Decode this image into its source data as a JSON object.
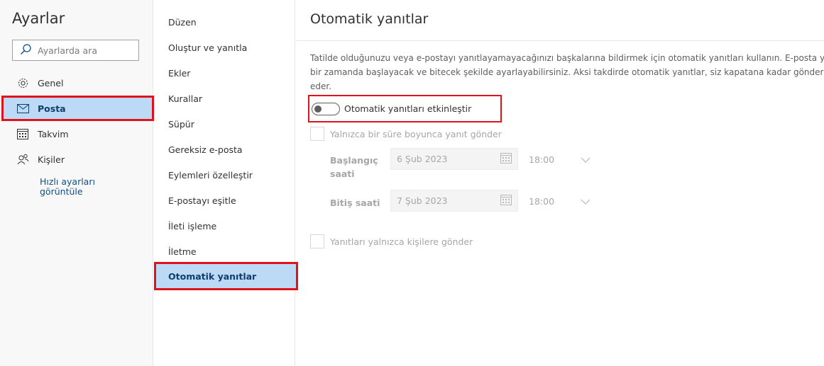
{
  "settings": {
    "title": "Ayarlar",
    "search_placeholder": "Ayarlarda ara",
    "nav": [
      {
        "label": "Genel",
        "icon": "gear-icon"
      },
      {
        "label": "Posta",
        "icon": "mail-icon"
      },
      {
        "label": "Takvim",
        "icon": "calendar-icon"
      },
      {
        "label": "Kişiler",
        "icon": "people-icon"
      }
    ],
    "quick_link": "Hızlı ayarları görüntüle"
  },
  "mail_menu": [
    "Düzen",
    "Oluştur ve yanıtla",
    "Ekler",
    "Kurallar",
    "Süpür",
    "Gereksiz e-posta",
    "Eylemleri özelleştir",
    "E-postayı eşitle",
    "İleti işleme",
    "İletme",
    "Otomatik yanıtlar"
  ],
  "auto_reply": {
    "title": "Otomatik yanıtlar",
    "description_lines": [
      "Tatilde olduğunuzu veya e-postayı yanıtlayamayacağınızı başkalarına bildirmek için otomatik yanıtları kullanın. E-posta y",
      "bir zamanda başlayacak ve bitecek şekilde ayarlayabilirsiniz. Aksi takdirde otomatik yanıtlar, siz kapatana kadar gönderil",
      "eder."
    ],
    "toggle_label": "Otomatik yanıtları etkinleştir",
    "toggle_on": false,
    "period_checkbox_label": "Yalnızca bir süre boyunca yanıt gönder",
    "start_label": "Başlangıç saati",
    "start_date": "6 Şub 2023",
    "start_time": "18:00",
    "end_label": "Bitiş saati",
    "end_date": "7 Şub 2023",
    "end_time": "18:00",
    "contacts_checkbox_label": "Yanıtları yalnızca kişilere gönder"
  },
  "colors": {
    "selected_bg": "#bcd9f5",
    "highlight_border": "#e0131b",
    "link": "#0e4f85"
  }
}
